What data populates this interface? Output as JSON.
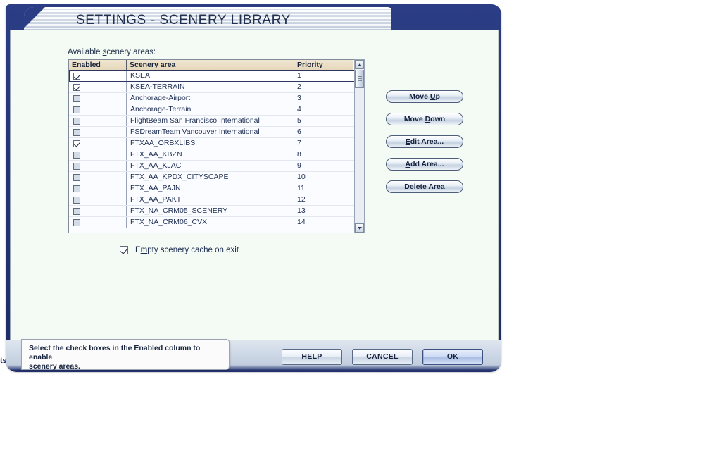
{
  "background": {
    "clipped_label": "ts"
  },
  "dialog": {
    "title": "SETTINGS - SCENERY LIBRARY",
    "group_label_pre": "Available ",
    "group_label_mn": "s",
    "group_label_post": "cenery areas:",
    "colors": {
      "frame": "#253575",
      "panel": "#f4faf4",
      "header": "#e5d7ba",
      "accent": "#2b3d85"
    }
  },
  "grid": {
    "columns": [
      "Enabled",
      "Scenery area",
      "Priority"
    ],
    "rows": [
      {
        "enabled": true,
        "area": "KSEA",
        "priority": "1",
        "selected": true
      },
      {
        "enabled": true,
        "area": "KSEA-TERRAIN",
        "priority": "2",
        "selected": false
      },
      {
        "enabled": false,
        "area": "Anchorage-Airport",
        "priority": "3",
        "selected": false
      },
      {
        "enabled": false,
        "area": "Anchorage-Terrain",
        "priority": "4",
        "selected": false
      },
      {
        "enabled": false,
        "area": "FlightBeam San Francisco International",
        "priority": "5",
        "selected": false
      },
      {
        "enabled": false,
        "area": "FSDreamTeam Vancouver International",
        "priority": "6",
        "selected": false
      },
      {
        "enabled": true,
        "area": "FTXAA_ORBXLIBS",
        "priority": "7",
        "selected": false
      },
      {
        "enabled": false,
        "area": "FTX_AA_KBZN",
        "priority": "8",
        "selected": false
      },
      {
        "enabled": false,
        "area": "FTX_AA_KJAC",
        "priority": "9",
        "selected": false
      },
      {
        "enabled": false,
        "area": "FTX_AA_KPDX_CITYSCAPE",
        "priority": "10",
        "selected": false
      },
      {
        "enabled": false,
        "area": "FTX_AA_PAJN",
        "priority": "11",
        "selected": false
      },
      {
        "enabled": false,
        "area": "FTX_AA_PAKT",
        "priority": "12",
        "selected": false
      },
      {
        "enabled": false,
        "area": "FTX_NA_CRM05_SCENERY",
        "priority": "13",
        "selected": false
      },
      {
        "enabled": false,
        "area": "FTX_NA_CRM06_CVX",
        "priority": "14",
        "selected": false
      }
    ]
  },
  "side_buttons": [
    {
      "pre": "Move ",
      "mn": "U",
      "post": "p"
    },
    {
      "pre": "Move ",
      "mn": "D",
      "post": "own"
    },
    {
      "pre": "",
      "mn": "E",
      "post": "dit Area..."
    },
    {
      "pre": "",
      "mn": "A",
      "post": "dd Area..."
    },
    {
      "pre": "Del",
      "mn": "e",
      "post": "te Area"
    }
  ],
  "option": {
    "label_pre": "E",
    "label_mn": "m",
    "label_post": "pty scenery cache on exit",
    "checked": true
  },
  "status": {
    "line1": "Select the check boxes in the Enabled column to enable",
    "line2": "scenery areas."
  },
  "bottom_buttons": [
    {
      "label": "HELP",
      "primary": false
    },
    {
      "label": "CANCEL",
      "primary": false
    },
    {
      "label": "OK",
      "primary": true
    }
  ]
}
